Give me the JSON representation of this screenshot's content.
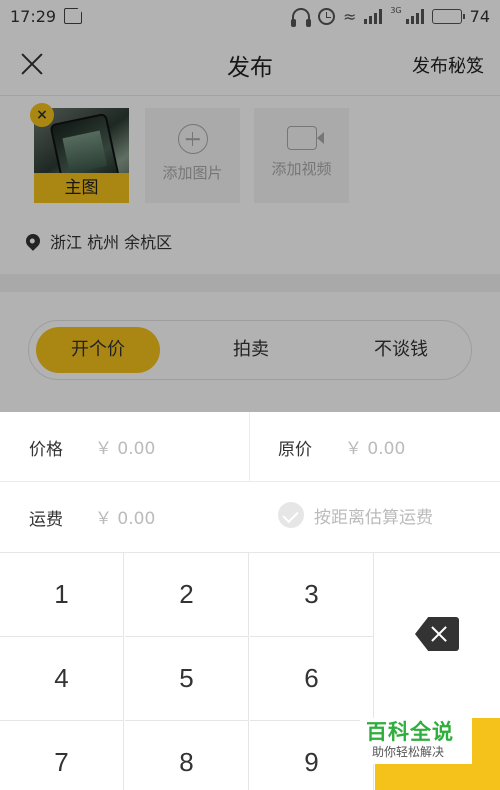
{
  "status_bar": {
    "time": "17:29",
    "network_label": "3G",
    "battery": "74",
    "battery_level": 0.74
  },
  "header": {
    "title": "发布",
    "tips_link": "发布秘笈"
  },
  "media": {
    "main_photo_label": "主图",
    "remove_icon": "×",
    "add_photo_label": "添加图片",
    "add_video_label": "添加视频",
    "location": "浙江 杭州 余杭区"
  },
  "price_type": {
    "options": [
      "开个价",
      "拍卖",
      "不谈钱"
    ],
    "selected_index": 0
  },
  "price_panel": {
    "price_label": "价格",
    "price_placeholder": "￥ 0.00",
    "original_price_label": "原价",
    "original_price_placeholder": "￥ 0.00",
    "shipping_label": "运费",
    "shipping_placeholder": "￥ 0.00",
    "distance_option": "按距离估算运费"
  },
  "keypad": {
    "keys": [
      "1",
      "2",
      "3",
      "4",
      "5",
      "6",
      "7",
      "8",
      "9"
    ]
  },
  "watermark": {
    "title": "百科全说",
    "subtitle": "助你轻松解决"
  },
  "colors": {
    "accent": "#f4c21b",
    "watermark_green": "#2eae3c"
  }
}
